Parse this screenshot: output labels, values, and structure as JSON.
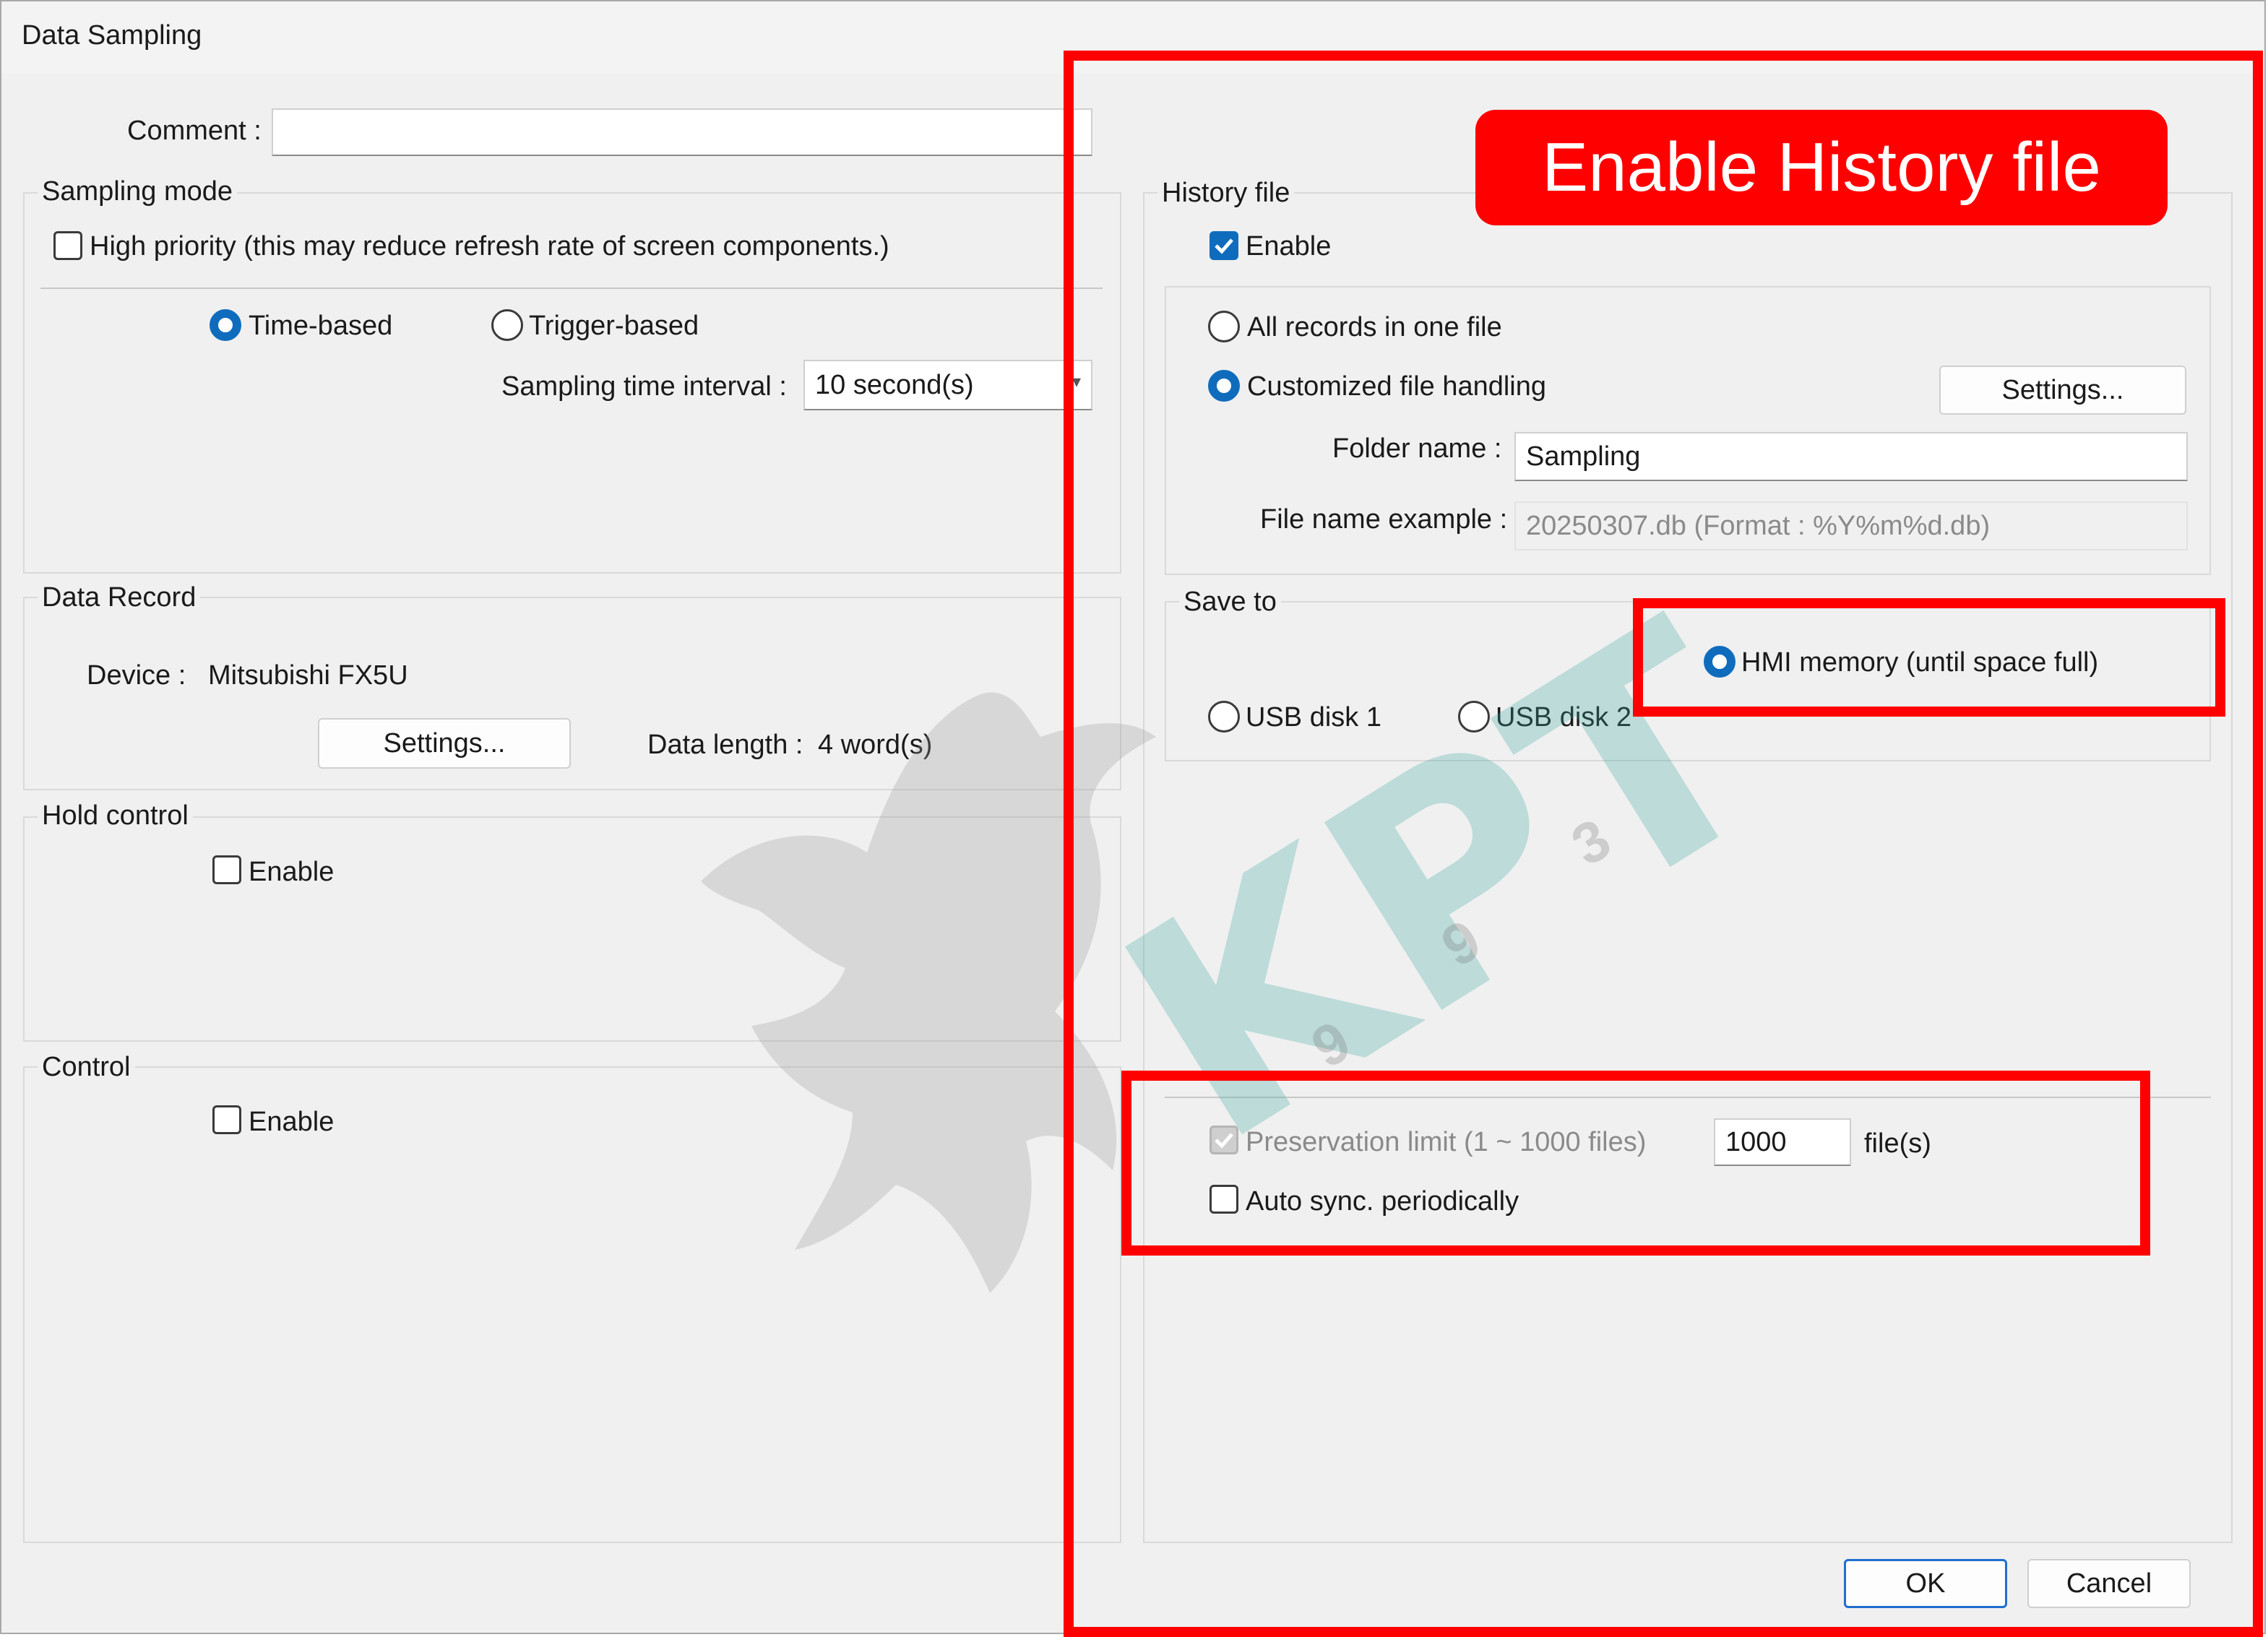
{
  "window": {
    "title": "Data Sampling"
  },
  "comment": {
    "label": "Comment :",
    "value": ""
  },
  "sampling_mode": {
    "legend": "Sampling mode",
    "high_priority_label": "High priority (this may reduce refresh rate of screen components.)",
    "time_based_label": "Time-based",
    "trigger_based_label": "Trigger-based",
    "interval_label": "Sampling time interval :",
    "interval_value": "10 second(s)"
  },
  "data_record": {
    "legend": "Data Record",
    "device_label": "Device :",
    "device_value": "Mitsubishi FX5U",
    "settings_label": "Settings...",
    "data_length_label": "Data length :",
    "data_length_value": "4 word(s)"
  },
  "hold_control": {
    "legend": "Hold control",
    "enable_label": "Enable"
  },
  "control": {
    "legend": "Control",
    "enable_label": "Enable"
  },
  "history_file": {
    "legend": "History file",
    "enable_label": "Enable",
    "all_records_label": "All records in one file",
    "customized_label": "Customized file handling",
    "settings_label": "Settings...",
    "folder_name_label": "Folder name :",
    "folder_name_value": "Sampling",
    "file_name_example_label": "File name example :",
    "file_name_example_value": "20250307.db (Format : %Y%m%d.db)",
    "save_to_legend": "Save to",
    "hmi_memory_label": "HMI memory (until space full)",
    "usb1_label": "USB disk 1",
    "usb2_label": "USB disk 2",
    "preservation_label": "Preservation limit (1 ~ 1000 files)",
    "preservation_value": "1000",
    "preservation_unit": "file(s)",
    "auto_sync_label": "Auto sync. periodically"
  },
  "buttons": {
    "ok": "OK",
    "cancel": "Cancel"
  },
  "annotation": {
    "callout_text": "Enable History file",
    "highlight_color": "#ff0000"
  },
  "watermark": {
    "text": "KPT",
    "digits": [
      "9",
      "9",
      "3"
    ]
  },
  "colors": {
    "accent": "#0f6cbd",
    "dialog_bg": "#f0f0f0"
  }
}
